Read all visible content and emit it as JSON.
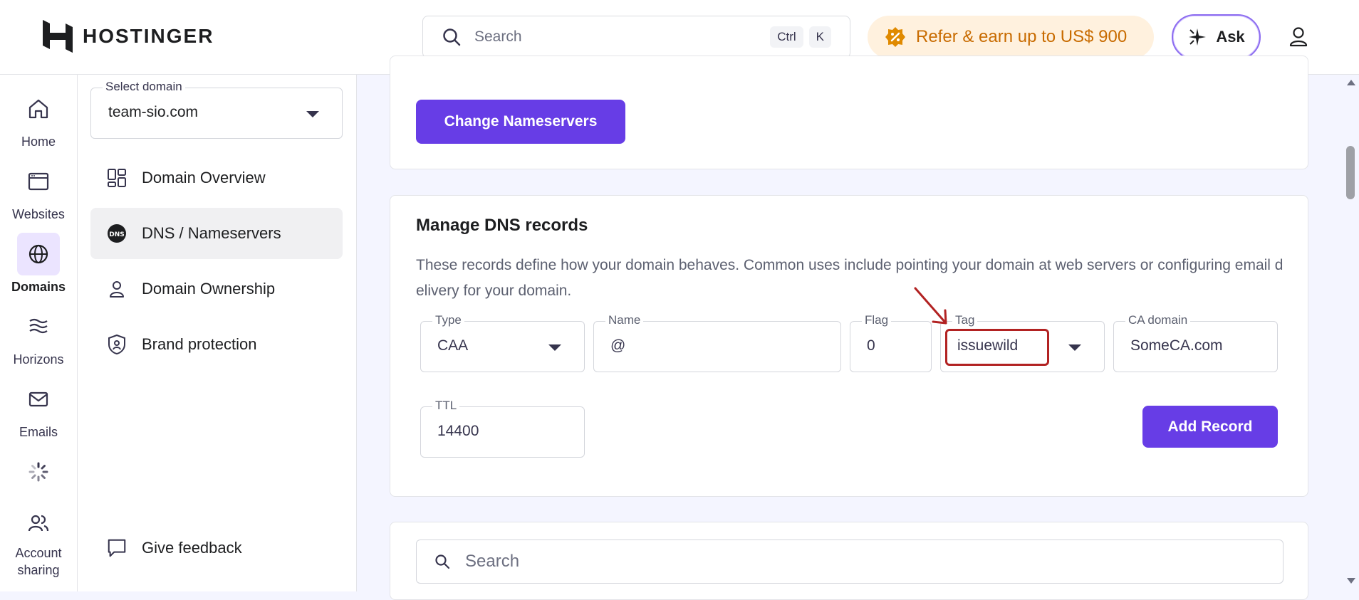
{
  "brand": {
    "name": "HOSTINGER"
  },
  "topbar": {
    "search_placeholder": "Search",
    "shortcut_keys": [
      "Ctrl",
      "K"
    ],
    "refer_text": "Refer & earn up to US$ 900",
    "ask_label": "Ask"
  },
  "rail": {
    "items": [
      {
        "label": "Home",
        "icon": "home-icon"
      },
      {
        "label": "Websites",
        "icon": "browser-window-icon"
      },
      {
        "label": "Domains",
        "icon": "globe-icon",
        "active": true
      },
      {
        "label": "Horizons",
        "icon": "horizons-icon"
      },
      {
        "label": "Emails",
        "icon": "envelope-icon"
      },
      {
        "label": "",
        "icon": "loading-spinner-icon"
      },
      {
        "label": "Account sharing",
        "icon": "users-icon"
      }
    ]
  },
  "subnav": {
    "select_label": "Select domain",
    "select_value": "team-sio.com",
    "items": [
      {
        "label": "Domain Overview",
        "icon": "grid-icon"
      },
      {
        "label": "DNS / Nameservers",
        "icon": "dns-icon",
        "active": true
      },
      {
        "label": "Domain Ownership",
        "icon": "person-icon"
      },
      {
        "label": "Brand protection",
        "icon": "shield-icon"
      }
    ],
    "feedback_label": "Give feedback"
  },
  "nameservers_card": {
    "button_label": "Change Nameservers"
  },
  "dns_card": {
    "title": "Manage DNS records",
    "description": "These records define how your domain behaves. Common uses include pointing your domain at web servers or configuring email delivery for your domain.",
    "fields": {
      "type": {
        "label": "Type",
        "value": "CAA"
      },
      "name": {
        "label": "Name",
        "value": "@"
      },
      "flag": {
        "label": "Flag",
        "value": "0"
      },
      "tag": {
        "label": "Tag",
        "value": "issuewild"
      },
      "ca_domain": {
        "label": "CA domain",
        "value": "SomeCA.com"
      },
      "ttl": {
        "label": "TTL",
        "value": "14400"
      }
    },
    "add_button_label": "Add Record"
  },
  "records_card": {
    "search_placeholder": "Search"
  },
  "colors": {
    "accent": "#673de6",
    "highlight": "#b22222",
    "refer_text": "#c86b00"
  }
}
